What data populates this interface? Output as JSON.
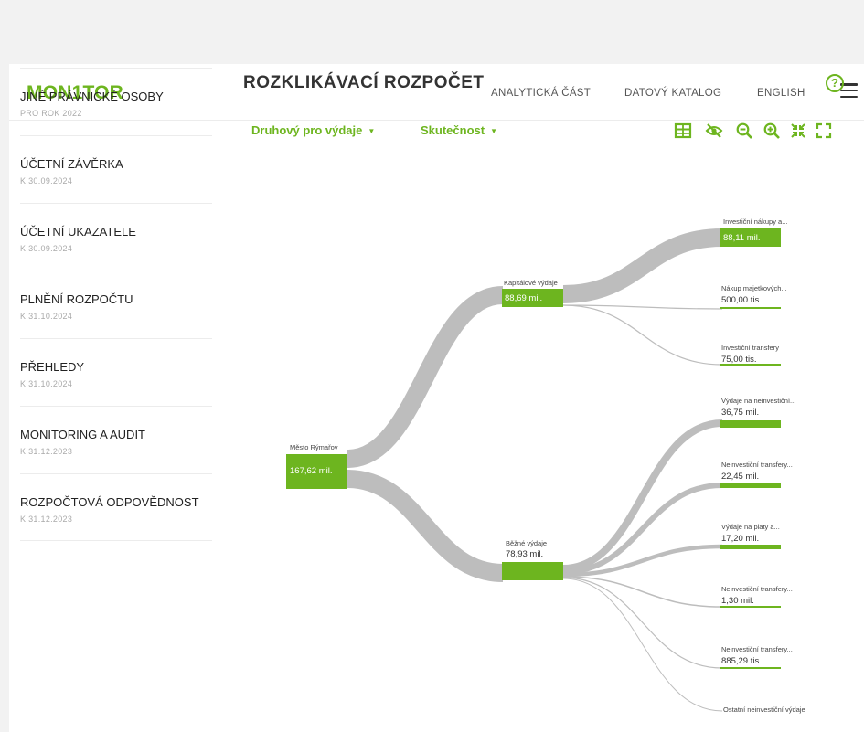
{
  "app": {
    "logo": "MON1TOR"
  },
  "nav": [
    {
      "label": "ANALYTICKÁ ČÁST"
    },
    {
      "label": "DATOVÝ KATALOG"
    },
    {
      "label": "ENGLISH"
    }
  ],
  "sidebar": {
    "items": [
      {
        "title": "JINÉ PRÁVNICKÉ OSOBY",
        "subtitle": "PRO ROK 2022"
      },
      {
        "title": "ÚČETNÍ ZÁVĚRKA",
        "subtitle": "K 30.09.2024"
      },
      {
        "title": "ÚČETNÍ UKAZATELE",
        "subtitle": "K 30.09.2024"
      },
      {
        "title": "PLNĚNÍ ROZPOČTU",
        "subtitle": "K 31.10.2024"
      },
      {
        "title": "PŘEHLEDY",
        "subtitle": "K 31.10.2024"
      },
      {
        "title": "MONITORING A AUDIT",
        "subtitle": "K 31.12.2023"
      },
      {
        "title": "ROZPOČTOVÁ ODPOVĚDNOST",
        "subtitle": "K 31.12.2023"
      }
    ]
  },
  "main": {
    "title": "ROZKLIKÁVACÍ ROZPOČET",
    "help": "?",
    "filters": [
      {
        "label": "Druhový pro výdaje"
      },
      {
        "label": "Skutečnost"
      }
    ],
    "toolbar": [
      "table-icon",
      "hide-icon",
      "zoom-out-icon",
      "zoom-in-icon",
      "collapse-icon",
      "fullscreen-icon"
    ]
  },
  "sankey": {
    "root": {
      "label": "Město Rýmařov",
      "value": "167,62 mil."
    },
    "level1": [
      {
        "label": "Kapitálové výdaje",
        "value": "88,69 mil."
      },
      {
        "label": "Běžné výdaje",
        "value": "78,93 mil."
      }
    ],
    "leaves": [
      {
        "label": "Investiční nákupy a...",
        "value": "88,11 mil."
      },
      {
        "label": "Nákup majetkových...",
        "value": "500,00 tis."
      },
      {
        "label": "Investiční transfery",
        "value": "75,00 tis."
      },
      {
        "label": "Výdaje na neinvestiční...",
        "value": "36,75 mil."
      },
      {
        "label": "Neinvestiční transfery...",
        "value": "22,45 mil."
      },
      {
        "label": "Výdaje na platy a...",
        "value": "17,20 mil."
      },
      {
        "label": "Neinvestiční transfery...",
        "value": "1,30 mil."
      },
      {
        "label": "Neinvestiční transfery...",
        "value": "885,29 tis."
      },
      {
        "label": "Ostatní neinvestiční výdaje",
        "value": ""
      }
    ],
    "colors": {
      "accent": "#6db51f",
      "flow": "#bdbdbd"
    }
  }
}
